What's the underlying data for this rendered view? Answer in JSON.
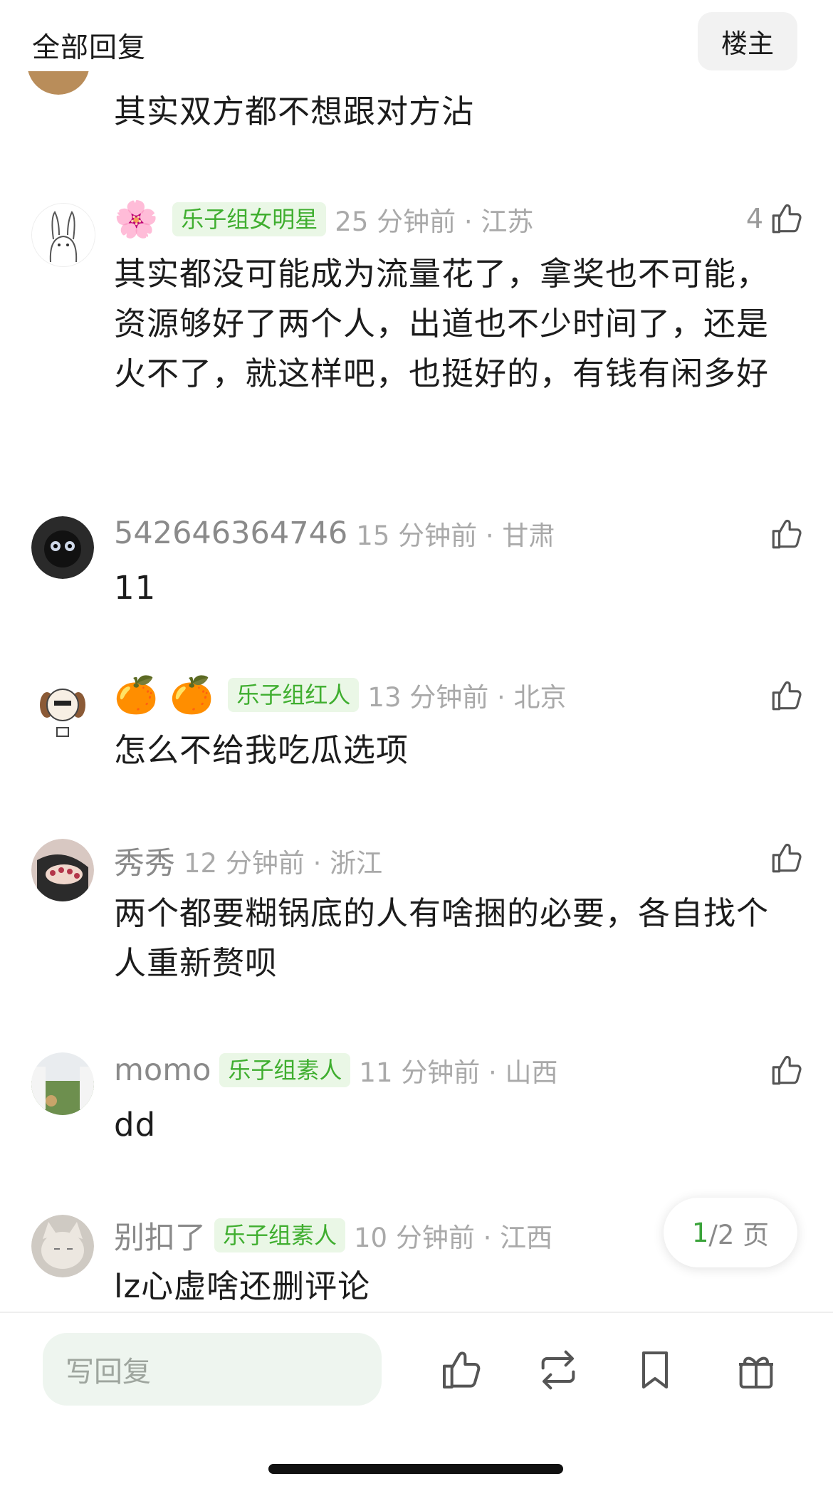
{
  "header": {
    "title": "全部回复",
    "owner_button": "楼主"
  },
  "comments": [
    {
      "text": "其实双方都不想跟对方沾"
    },
    {
      "emoji": "🌸",
      "badge": "乐子组女明星",
      "time": "25 分钟前 · 江苏",
      "likes": "4",
      "text": "其实都没可能成为流量花了，拿奖也不可能，资源够好了两个人，出道也不少时间了，还是火不了，就这样吧，也挺好的，有钱有闲多好"
    },
    {
      "username": "542646364746",
      "time": "15 分钟前 · 甘肃",
      "text": "11"
    },
    {
      "emoji": "🍊 🍊",
      "badge": "乐子组红人",
      "time": "13 分钟前 · 北京",
      "text": "怎么不给我吃瓜选项"
    },
    {
      "username": "秀秀",
      "time": "12 分钟前 · 浙江",
      "text": "两个都要糊锅底的人有啥捆的必要，各自找个人重新赘呗"
    },
    {
      "username": "momo",
      "badge": "乐子组素人",
      "time": "11 分钟前 · 山西",
      "text": "dd"
    },
    {
      "username": "别扣了",
      "badge": "乐子组素人",
      "time": "10 分钟前 · 江西",
      "text": "lz心虚啥还删评论"
    }
  ],
  "pager": {
    "current": "1",
    "rest": "/2 页"
  },
  "bottom_bar": {
    "reply_placeholder": "写回复",
    "icons": [
      "thumbs-up-icon",
      "repost-icon",
      "bookmark-icon",
      "gift-icon"
    ]
  },
  "colors": {
    "accent_green": "#3fae2f",
    "badge_bg": "#eaf7e6",
    "muted_text": "#8a8a8a"
  }
}
